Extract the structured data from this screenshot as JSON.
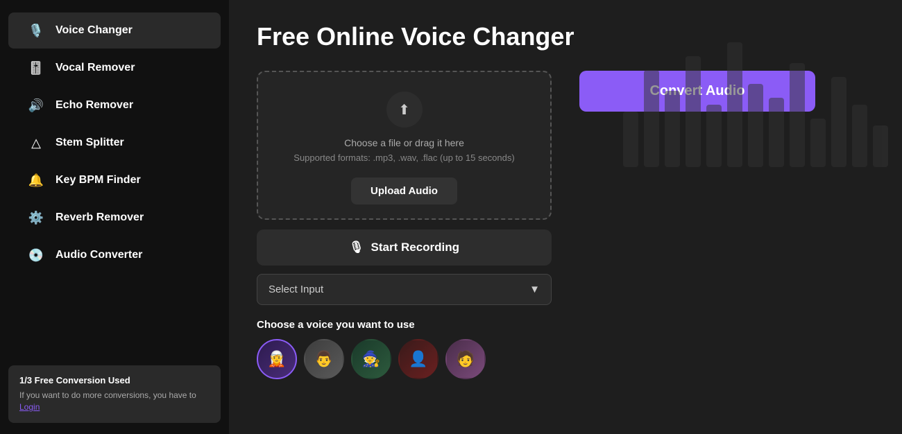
{
  "sidebar": {
    "items": [
      {
        "id": "voice-changer",
        "label": "Voice Changer",
        "icon": "🎙️",
        "active": true
      },
      {
        "id": "vocal-remover",
        "label": "Vocal Remover",
        "icon": "🎚️",
        "active": false
      },
      {
        "id": "echo-remover",
        "label": "Echo Remover",
        "icon": "🔊",
        "active": false
      },
      {
        "id": "stem-splitter",
        "label": "Stem Splitter",
        "icon": "△",
        "active": false
      },
      {
        "id": "key-bpm-finder",
        "label": "Key BPM Finder",
        "icon": "🔔",
        "active": false
      },
      {
        "id": "reverb-remover",
        "label": "Reverb Remover",
        "icon": "⚙️",
        "active": false
      },
      {
        "id": "audio-converter",
        "label": "Audio Converter",
        "icon": "💿",
        "active": false
      }
    ],
    "bottom": {
      "title": "1/3 Free Conversion Used",
      "text": "If you want to do more conversions, you have to ",
      "link_label": "Login"
    }
  },
  "main": {
    "title": "Free Online Voice Changer",
    "upload_zone": {
      "hint": "Choose a file or drag it here",
      "formats": "Supported formats: .mp3, .wav, .flac (up to 15 seconds)",
      "upload_btn_label": "Upload Audio"
    },
    "record_btn_label": "Start Recording",
    "select_input_placeholder": "Select Input",
    "voice_section_label": "Choose a voice you want to use",
    "voices": [
      {
        "id": "v1",
        "emoji": "🧝",
        "active": true
      },
      {
        "id": "v2",
        "emoji": "👨",
        "active": false
      },
      {
        "id": "v3",
        "emoji": "🧙",
        "active": false
      },
      {
        "id": "v4",
        "emoji": "👤",
        "active": false
      },
      {
        "id": "v5",
        "emoji": "🧑",
        "active": false
      }
    ],
    "convert_btn_label": "Convert Audio"
  },
  "icons": {
    "microphone": "🎙",
    "upload": "⬆",
    "chevron_down": "▼",
    "bars": "▐"
  }
}
